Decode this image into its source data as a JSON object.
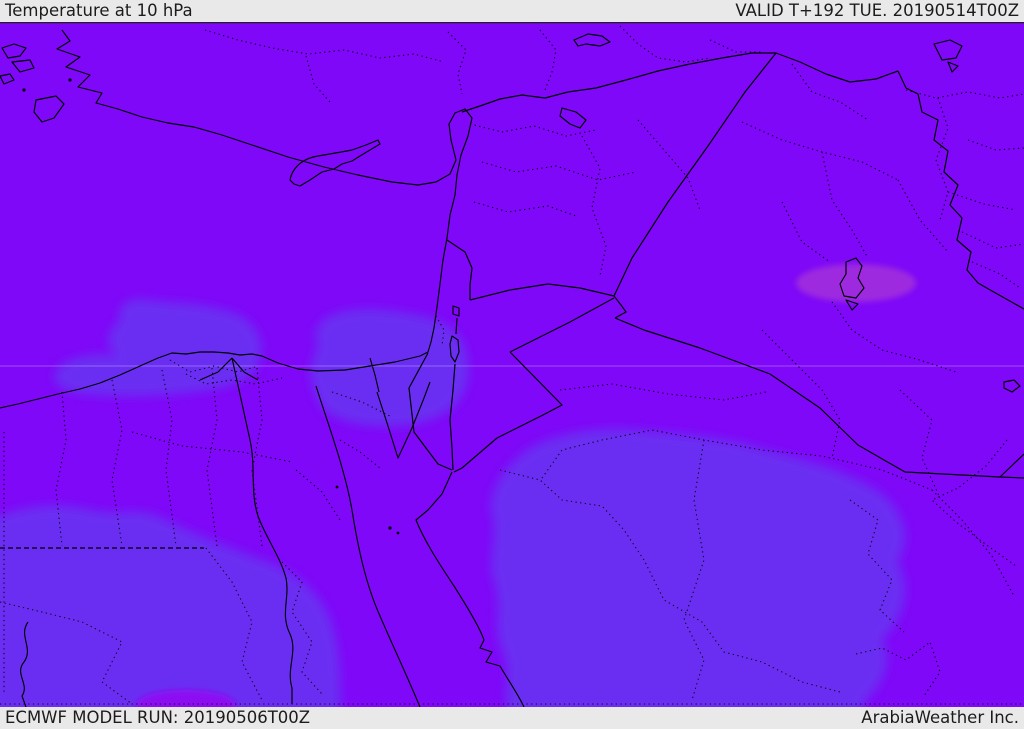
{
  "header": {
    "title_left": "Temperature at 10 hPa",
    "title_right": "VALID T+192 TUE. 20190514T00Z"
  },
  "footer": {
    "model_run": "ECMWF MODEL RUN: 20190506T00Z",
    "credit": "ArabiaWeather Inc."
  },
  "map_meta": {
    "parameter": "Temperature",
    "level": "10 hPa",
    "model": "ECMWF",
    "run_time": "20190506T00Z",
    "valid_time": "20190514T00Z",
    "lead_time": "T+192",
    "valid_day": "TUE."
  },
  "colors": {
    "bar_background": "#e9e9e9",
    "bar_text": "#1c1c1c",
    "map_background": "#7e08f7",
    "cold_band": "#6b2df2",
    "warmer_band_blob": "#8d0af2",
    "warm_ellipse": "#9e2cdf",
    "boundary_line": "#000000",
    "map_frame_line": "#222222",
    "gridline": "#ffffff"
  }
}
